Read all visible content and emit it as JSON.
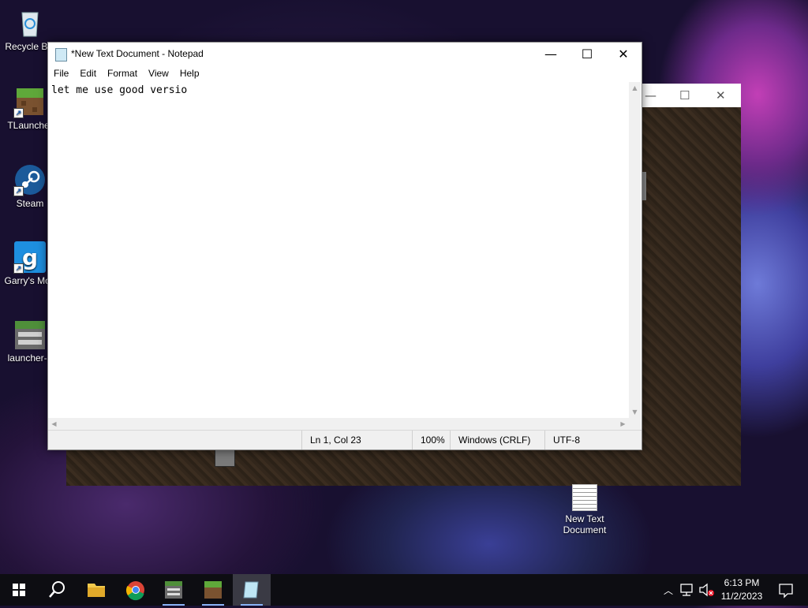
{
  "desktop": {
    "icons": [
      {
        "label": "Recycle Bin",
        "icon": "recycle-bin-icon"
      },
      {
        "label": "TLauncher",
        "icon": "tlauncher-icon"
      },
      {
        "label": "Steam",
        "icon": "steam-icon"
      },
      {
        "label": "Garry's Mod",
        "icon": "garrys-mod-icon"
      },
      {
        "label": "launcher-1",
        "icon": "betacraft-icon"
      }
    ],
    "file": {
      "label_line1": "New Text",
      "label_line2": "Document",
      "icon": "text-document-icon"
    }
  },
  "notepad": {
    "title": "*New Text Document - Notepad",
    "menu": [
      "File",
      "Edit",
      "Format",
      "View",
      "Help"
    ],
    "content": "let me use good versio",
    "status": {
      "position": "Ln 1, Col 23",
      "zoom": "100%",
      "line_endings": "Windows (CRLF)",
      "encoding": "UTF-8"
    }
  },
  "taskbar": {
    "apps": [
      "start-icon",
      "search-icon",
      "file-explorer-icon",
      "chrome-icon",
      "betacraft-icon",
      "minecraft-icon",
      "notepad-icon"
    ],
    "clock": {
      "time": "6:13 PM",
      "date": "11/2/2023"
    }
  },
  "colors": {
    "taskbar": "#0d0d12",
    "accent": "#8ab4f8"
  }
}
